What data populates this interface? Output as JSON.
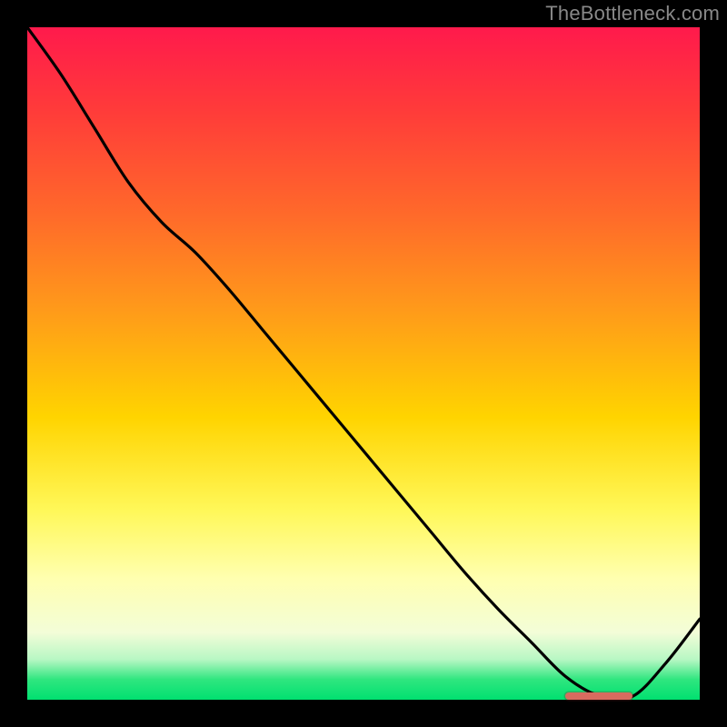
{
  "source": "TheBottleneck.com",
  "chart_data": {
    "type": "line",
    "title": "",
    "xlabel": "",
    "ylabel": "",
    "x": [
      0.0,
      0.05,
      0.1,
      0.15,
      0.2,
      0.25,
      0.3,
      0.35,
      0.4,
      0.45,
      0.5,
      0.55,
      0.6,
      0.65,
      0.7,
      0.75,
      0.8,
      0.85,
      0.9,
      0.95,
      1.0
    ],
    "values": [
      100,
      93,
      85,
      77,
      71,
      66.5,
      61,
      55,
      49,
      43,
      37,
      31,
      25,
      19,
      13.5,
      8.5,
      3.5,
      0.6,
      0.5,
      5.5,
      12
    ],
    "ylim": [
      0,
      100
    ],
    "xlim": [
      0,
      1
    ],
    "gradient_stops": [
      {
        "pos": 0.0,
        "color": "#ff1a4c"
      },
      {
        "pos": 0.12,
        "color": "#ff3a3a"
      },
      {
        "pos": 0.28,
        "color": "#ff6a2a"
      },
      {
        "pos": 0.42,
        "color": "#ff9a1a"
      },
      {
        "pos": 0.58,
        "color": "#ffd400"
      },
      {
        "pos": 0.72,
        "color": "#fff85a"
      },
      {
        "pos": 0.82,
        "color": "#ffffb0"
      },
      {
        "pos": 0.9,
        "color": "#f3fdd8"
      },
      {
        "pos": 0.94,
        "color": "#b8f7c4"
      },
      {
        "pos": 0.97,
        "color": "#2fe67f"
      },
      {
        "pos": 1.0,
        "color": "#00e070"
      }
    ],
    "optimum_marker": {
      "x_start": 0.8,
      "x_end": 0.9,
      "y": 0.5,
      "color": "#d86b5f"
    }
  }
}
